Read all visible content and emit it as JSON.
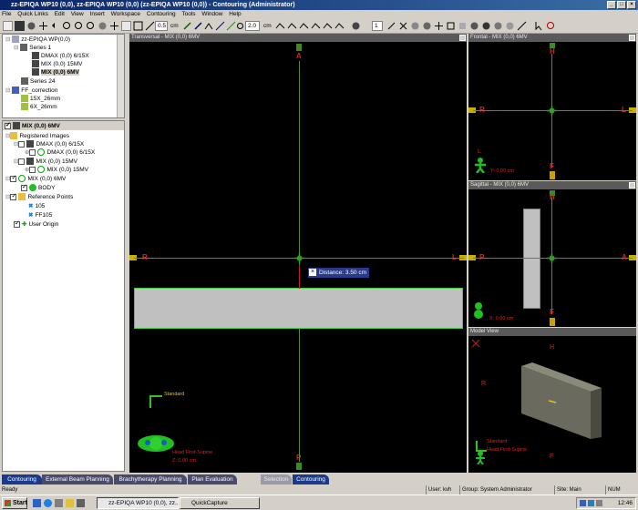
{
  "window": {
    "title": "zz-EPIQA WP10 (0,0), zz-EPIQA WP10 (0,0) (zz-EPIQA WP10 (0,0)) - Contouring (Administrator)"
  },
  "menu": [
    "File",
    "Quick Links",
    "Edit",
    "View",
    "Insert",
    "Workspace",
    "Contouring",
    "Tools",
    "Window",
    "Help"
  ],
  "toolbar": {
    "zoom_value": "0.5",
    "zoom_unit": "cm",
    "step_value": "2.0",
    "step_unit": "cm",
    "slice_value": "1"
  },
  "tree_top": {
    "root": "zz-EPIQA WP(0,0)",
    "series1": "Series 1",
    "items": [
      "DMAX (0,0) 6/15X",
      "MIX (0,0) 15MV",
      "MIX (0,0) 6MV"
    ],
    "series24": "Series 24",
    "ff": "FF_correction",
    "ff_items": [
      "15X_26mm",
      "6X_26mm"
    ]
  },
  "tree_bottom": {
    "header": "MIX (0,0) 6MV",
    "registered": "Registered Images",
    "dmax": "DMAX (0,0) 6/15X",
    "dmax_child": "DMAX (0,0) 6/15X",
    "mix15": "MIX (0,0) 15MV",
    "mix15_child": "MIX (0,0) 15MV",
    "mix6": "MIX (0,0) 6MV",
    "body": "BODY",
    "refpoints": "Reference Points",
    "ref1": "105",
    "ref2": "FF105",
    "origin": "User Origin"
  },
  "views": {
    "transversal": {
      "title": "Transversal - MIX (0,0) 6MV",
      "top": "A",
      "bottom": "P",
      "left": "R",
      "right": "L",
      "distance": "Distance: 3.50 cm",
      "standard": "Standard",
      "orientation": "Head First-Supine",
      "z": "Z: 0.00 cm"
    },
    "frontal": {
      "title": "Frontal - MIX (0,0) 6MV",
      "top": "H",
      "bottom": "F",
      "left": "R",
      "right": "L",
      "person": "L",
      "y": "Y: 0.00 cm"
    },
    "sagittal": {
      "title": "Sagittal - MIX (0,0) 6MV",
      "top": "H",
      "bottom": "F",
      "left": "P",
      "right": "A",
      "x": "X: 0.00 cm"
    },
    "model": {
      "title": "Model View",
      "h": "H",
      "r": "R",
      "f": "F",
      "standard": "Standard",
      "orientation": "Head First-Supine"
    }
  },
  "tabs": [
    "Contouring",
    "External Beam Planning",
    "Brachytherapy Planning",
    "Plan Evaluation",
    "Selection",
    "Contouring"
  ],
  "status": {
    "ready": "Ready",
    "user": "User: kvh",
    "group": "Group: System Administrator",
    "site": "Site: Main",
    "num": "NUM"
  },
  "taskbar": {
    "start": "Start",
    "task1": "zz-EPIQA WP10 (0,0), zz...",
    "task2": "QuickCapture",
    "clock": "12:46"
  }
}
